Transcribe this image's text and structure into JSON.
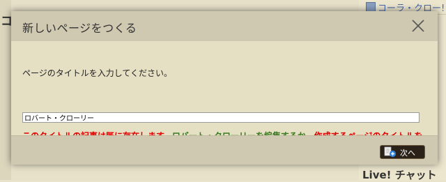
{
  "background": {
    "left_text": "コ",
    "right_link": "コーラ・クロー!",
    "live_heading": "Live! チャット"
  },
  "dialog": {
    "title": "新しいページをつくる",
    "prompt": "ページのタイトルを入力してください。",
    "input_value": "ロバート・クローリー",
    "warning_part1": "このタイトルの記事は既に存在します。",
    "warning_link": "ロバート・クローリーを編集するか",
    "warning_part2": "、作成するページのタイトルを変更してください。",
    "next_label": "次へ",
    "next_icon": "new-page-icon",
    "close_icon": "close-icon"
  },
  "colors": {
    "warning": "#e00000",
    "link": "#3a7a20",
    "header": "#cfc9b1",
    "body": "#e5dfc3"
  }
}
